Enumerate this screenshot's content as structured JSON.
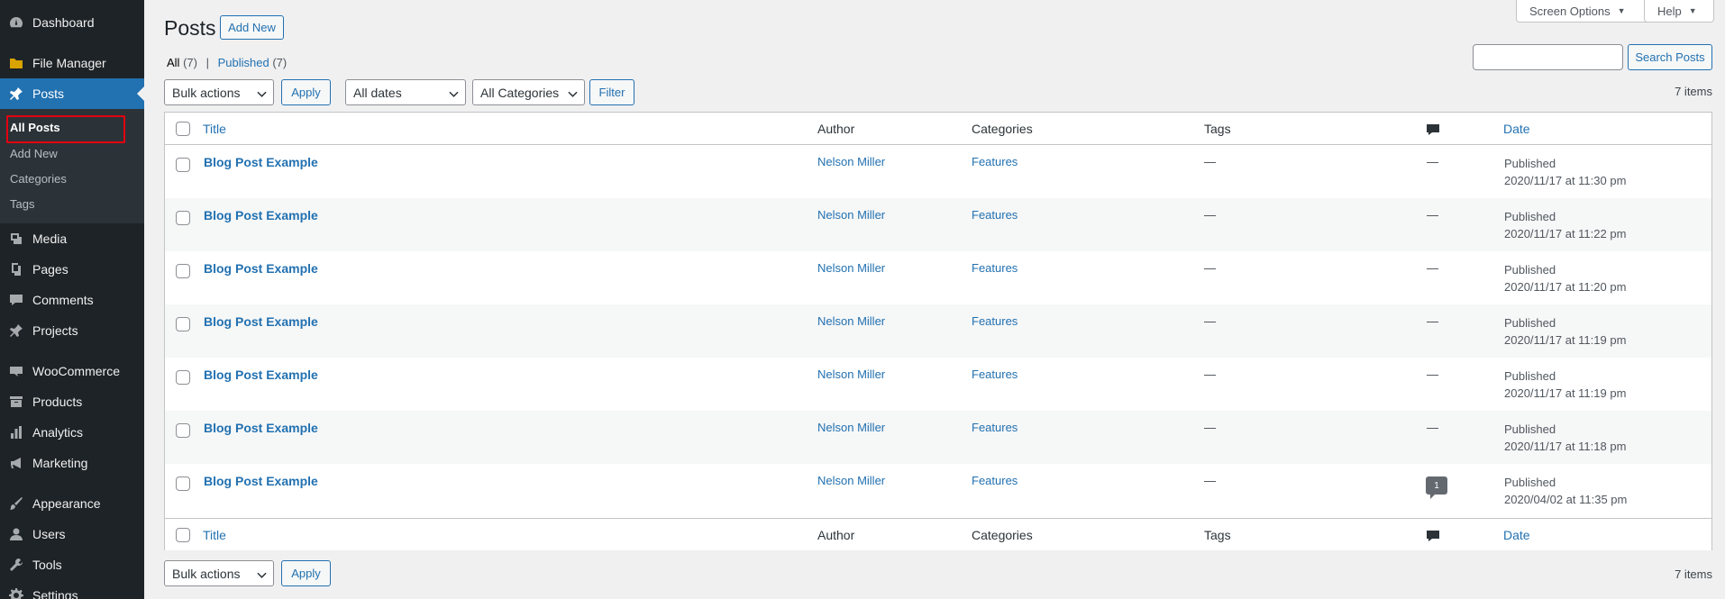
{
  "sidebar": {
    "items": [
      {
        "label": "Dashboard",
        "icon": "dashboard-icon"
      },
      {
        "label": "File Manager",
        "icon": "folder-icon"
      },
      {
        "label": "Posts",
        "icon": "pin-icon"
      },
      {
        "label": "Media",
        "icon": "media-icon"
      },
      {
        "label": "Pages",
        "icon": "pages-icon"
      },
      {
        "label": "Comments",
        "icon": "comment-icon"
      },
      {
        "label": "Projects",
        "icon": "pin-icon"
      },
      {
        "label": "WooCommerce",
        "icon": "woo-icon"
      },
      {
        "label": "Products",
        "icon": "archive-icon"
      },
      {
        "label": "Analytics",
        "icon": "chart-icon"
      },
      {
        "label": "Marketing",
        "icon": "megaphone-icon"
      },
      {
        "label": "Appearance",
        "icon": "brush-icon"
      },
      {
        "label": "Users",
        "icon": "user-icon"
      },
      {
        "label": "Tools",
        "icon": "wrench-icon"
      },
      {
        "label": "Settings",
        "icon": "settings-icon"
      }
    ],
    "submenu": [
      "All Posts",
      "Add New",
      "Categories",
      "Tags"
    ]
  },
  "header": {
    "title": "Posts",
    "add_new": "Add New",
    "screen_options": "Screen Options",
    "help": "Help"
  },
  "views": {
    "all_label": "All",
    "all_count": "(7)",
    "separator": "|",
    "published_label": "Published",
    "published_count": "(7)"
  },
  "search": {
    "button": "Search Posts",
    "value": ""
  },
  "filters": {
    "bulk_actions": "Bulk actions",
    "apply": "Apply",
    "dates": "All dates",
    "categories": "All Categories",
    "filter": "Filter",
    "items_count": "7 items"
  },
  "table": {
    "columns": {
      "title": "Title",
      "author": "Author",
      "categories": "Categories",
      "tags": "Tags",
      "date": "Date"
    },
    "rows": [
      {
        "title": "Blog Post Example",
        "author": "Nelson Miller",
        "categories": "Features",
        "tags": "—",
        "comments": "—",
        "status": "Published",
        "date": "2020/11/17 at 11:30 pm"
      },
      {
        "title": "Blog Post Example",
        "author": "Nelson Miller",
        "categories": "Features",
        "tags": "—",
        "comments": "—",
        "status": "Published",
        "date": "2020/11/17 at 11:22 pm"
      },
      {
        "title": "Blog Post Example",
        "author": "Nelson Miller",
        "categories": "Features",
        "tags": "—",
        "comments": "—",
        "status": "Published",
        "date": "2020/11/17 at 11:20 pm"
      },
      {
        "title": "Blog Post Example",
        "author": "Nelson Miller",
        "categories": "Features",
        "tags": "—",
        "comments": "—",
        "status": "Published",
        "date": "2020/11/17 at 11:19 pm"
      },
      {
        "title": "Blog Post Example",
        "author": "Nelson Miller",
        "categories": "Features",
        "tags": "—",
        "comments": "—",
        "status": "Published",
        "date": "2020/11/17 at 11:19 pm"
      },
      {
        "title": "Blog Post Example",
        "author": "Nelson Miller",
        "categories": "Features",
        "tags": "—",
        "comments": "—",
        "status": "Published",
        "date": "2020/11/17 at 11:18 pm"
      },
      {
        "title": "Blog Post Example",
        "author": "Nelson Miller",
        "categories": "Features",
        "tags": "—",
        "comments": "1",
        "status": "Published",
        "date": "2020/04/02 at 11:35 pm"
      }
    ]
  },
  "colors": {
    "sidebar_bg": "#1d2327",
    "submenu_bg": "#2c3338",
    "active": "#2271b1",
    "highlight": "#e3000f"
  }
}
